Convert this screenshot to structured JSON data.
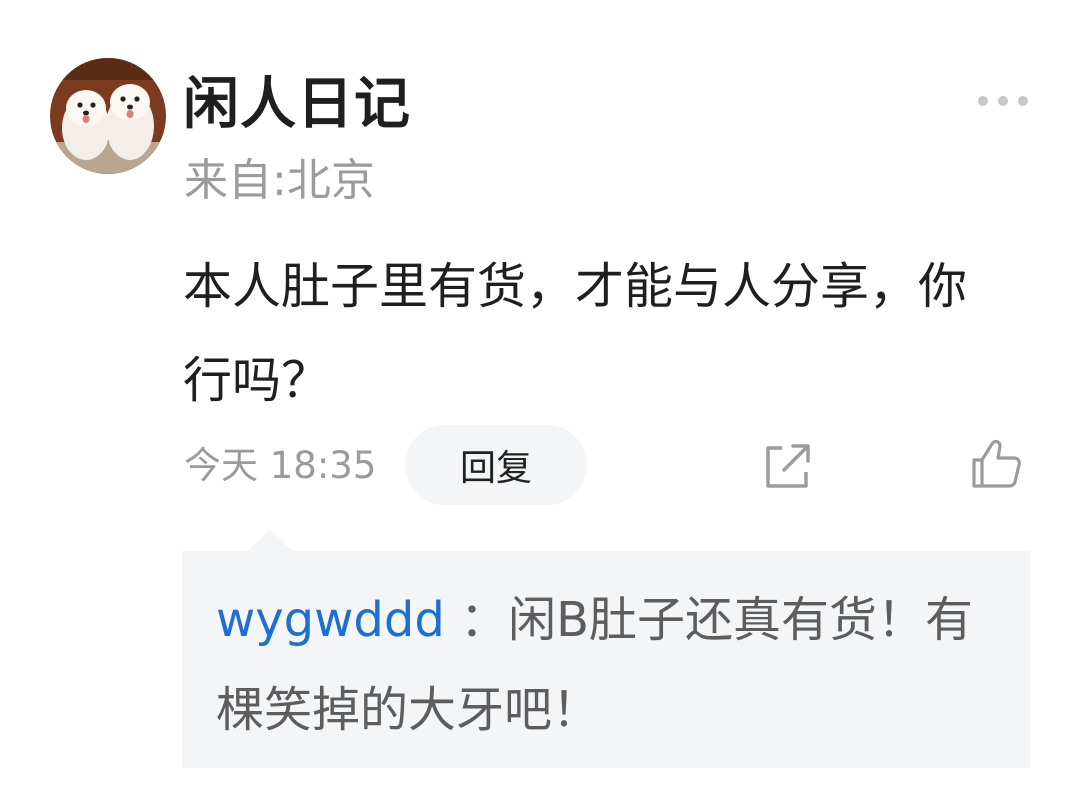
{
  "user": {
    "name": "闲人日记",
    "location": "来自:北京",
    "avatar_icon": "samoyed-puppies-avatar"
  },
  "comment": {
    "text": "本人肚子里有货，才能与人分享，你行吗？",
    "time": "今天 18:35",
    "reply_label": "回复"
  },
  "actions": {
    "more_icon": "more-horizontal-icon",
    "share_icon": "share-icon",
    "like_icon": "thumbs-up-icon"
  },
  "reply": {
    "author": "wygwddd",
    "separator": " ：",
    "text": "闲B肚子还真有货！有棵笑掉的大牙吧！"
  },
  "colors": {
    "link_blue": "#1e6fd0",
    "muted_gray": "#9b9b9b",
    "reply_bg": "#f4f5f7",
    "text_dark": "#1f1f1f"
  }
}
